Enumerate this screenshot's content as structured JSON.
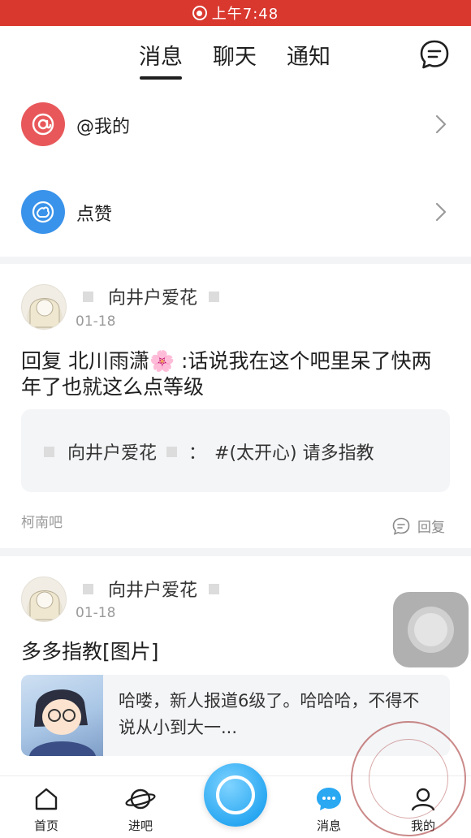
{
  "status_bar": {
    "time": "上午7:48"
  },
  "top_nav": {
    "tabs": [
      "消息",
      "聊天",
      "通知"
    ],
    "active_tab": "消息",
    "chat_icon": "chat-bubble-icon"
  },
  "entries": [
    {
      "label": "@我的",
      "icon": "at-icon",
      "color": "#e8585a"
    },
    {
      "label": "点赞",
      "icon": "thumb-up-icon",
      "color": "#3a93ea"
    }
  ],
  "messages": [
    {
      "username": "向井户爱花",
      "date": "01-18",
      "text": "回复 北川雨潇🌸 :话说我在这个吧里呆了快两年了也就这么点等级",
      "quote_user": "向井户爱花",
      "quote_sep": "：",
      "quote_text": "#(太开心) 请多指教",
      "forum": "柯南吧",
      "reply_label": "回复"
    },
    {
      "username": "向井户爱花",
      "date": "01-18",
      "text": "多多指教[图片]",
      "preview_text": "哈喽，新人报道6级了。哈哈哈，不得不说从小到大一..."
    }
  ],
  "bottom_nav": {
    "items": [
      {
        "label": "首页",
        "icon": "home-icon"
      },
      {
        "label": "进吧",
        "icon": "planet-icon"
      },
      {
        "label": "消息",
        "icon": "message-icon"
      },
      {
        "label": "我的",
        "icon": "profile-icon"
      }
    ],
    "center_icon": "post-button-icon"
  },
  "colors": {
    "status_bar": "#d9382f",
    "accent_blue": "#2aa8f2"
  }
}
